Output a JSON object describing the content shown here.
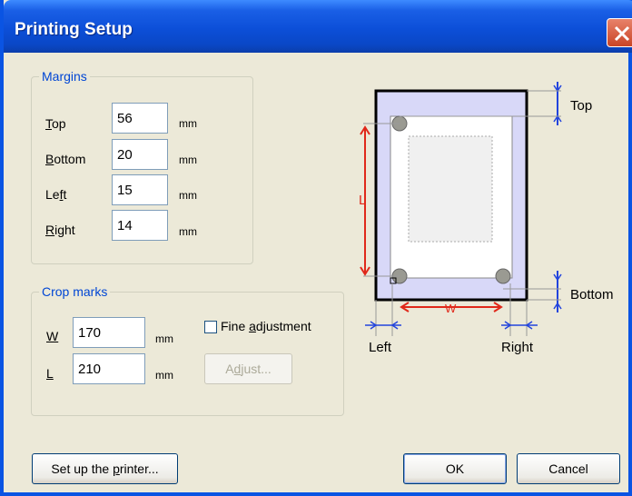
{
  "window": {
    "title": "Printing Setup"
  },
  "margins": {
    "legend": "Margins",
    "rows": [
      {
        "label_prefix": "",
        "label_underline": "T",
        "label_rest": "op",
        "value": "56",
        "unit": "mm"
      },
      {
        "label_prefix": "",
        "label_underline": "B",
        "label_rest": "ottom",
        "value": "20",
        "unit": "mm"
      },
      {
        "label_prefix": "Le",
        "label_underline": "f",
        "label_rest": "t",
        "value": "15",
        "unit": "mm"
      },
      {
        "label_prefix": "",
        "label_underline": "R",
        "label_rest": "ight",
        "value": "14",
        "unit": "mm"
      }
    ]
  },
  "crop_marks": {
    "legend": "Crop marks",
    "w_label": "W",
    "w_value": "170",
    "w_unit": "mm",
    "l_label": "L",
    "l_value": "210",
    "l_unit": "mm",
    "fine_adjust_prefix": "Fine ",
    "fine_adjust_underline": "a",
    "fine_adjust_rest": "djustment",
    "fine_adjust_checked": false,
    "adjust_prefix": "A",
    "adjust_underline": "d",
    "adjust_rest": "just..."
  },
  "diagram": {
    "top_label": "Top",
    "bottom_label": "Bottom",
    "left_label": "Left",
    "right_label": "Right",
    "w_label": "W",
    "l_label": "L"
  },
  "buttons": {
    "setup_prefix": "Set up the ",
    "setup_underline": "p",
    "setup_rest": "rinter...",
    "ok": "OK",
    "cancel": "Cancel"
  },
  "colors": {
    "accent": "#0046d5",
    "dimension_red": "#e0281a",
    "dimension_blue": "#2244dd",
    "paper_lavender": "#d8d8f8"
  }
}
